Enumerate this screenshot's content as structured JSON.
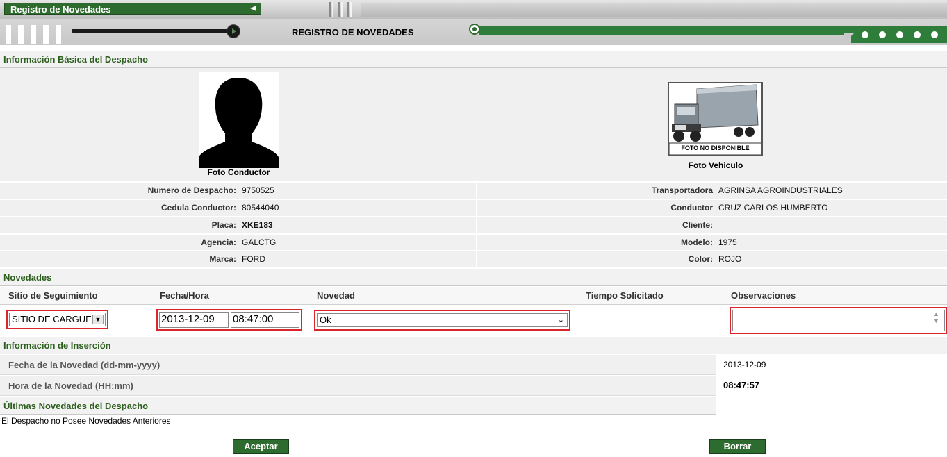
{
  "window": {
    "title": "Registro de Novedades"
  },
  "header": {
    "title": "REGISTRO DE NOVEDADES"
  },
  "basic_info": {
    "section_title": "Información Básica del Despacho",
    "driver_photo_caption": "Foto Conductor",
    "vehicle_photo_caption": "Foto Vehiculo",
    "vehicle_photo_placeholder": "FOTO NO DISPONIBLE",
    "left_fields": [
      {
        "label": "Numero de Despacho:",
        "value": "9750525"
      },
      {
        "label": "Cedula Conductor:",
        "value": "80544040"
      },
      {
        "label": "Placa:",
        "value": "XKE183"
      },
      {
        "label": "Agencia:",
        "value": "GALCTG"
      },
      {
        "label": "Marca:",
        "value": "FORD"
      }
    ],
    "right_fields": [
      {
        "label": "Transportadora",
        "value": "AGRINSA AGROINDUSTRIALES"
      },
      {
        "label": "Conductor",
        "value": "CRUZ CARLOS HUMBERTO"
      },
      {
        "label": "Cliente:",
        "value": ""
      },
      {
        "label": "Modelo:",
        "value": "1975"
      },
      {
        "label": "Color:",
        "value": "ROJO"
      }
    ]
  },
  "novedades": {
    "section_title": "Novedades",
    "columns": [
      "Sitio de Seguimiento",
      "Fecha/Hora",
      "Novedad",
      "Tiempo Solicitado",
      "Observaciones"
    ],
    "sitio_value": "SITIO DE CARGUE",
    "fecha_value": "2013-12-09",
    "hora_value": "08:47:00",
    "novedad_value": "Ok",
    "observaciones_value": ""
  },
  "insercion": {
    "section_title": "Información de Inserción",
    "fecha_label": "Fecha de la Novedad (dd-mm-yyyy)",
    "fecha_value": "2013-12-09",
    "hora_label": "Hora de la Novedad (HH:mm)",
    "hora_value": "08:47:57"
  },
  "ultimas": {
    "section_title": "Últimas Novedades del Despacho",
    "empty_message": "El Despacho no Posee Novedades Anteriores"
  },
  "buttons": {
    "accept": "Aceptar",
    "delete": "Borrar"
  },
  "colors": {
    "brand_green": "#2e6b2e",
    "section_text": "#2d5f1e",
    "highlight_red": "#d9262c"
  }
}
